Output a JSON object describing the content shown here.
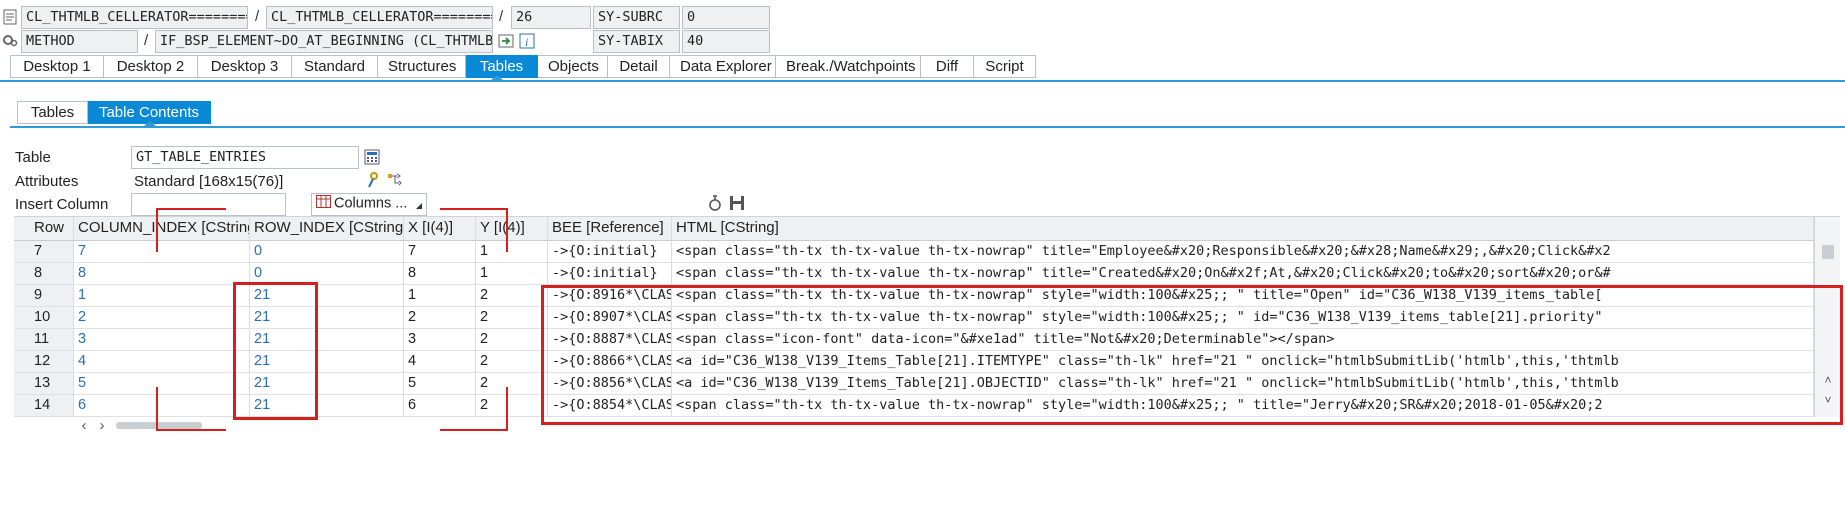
{
  "toolbar": {
    "row1": {
      "class1": "CL_THTMLB_CELLERATOR=========…",
      "class2": "CL_THTMLB_CELLERATOR=========…",
      "line": "26",
      "var_name": "SY-SUBRC",
      "var_value": "0"
    },
    "row2": {
      "kind": "METHOD",
      "method": "IF_BSP_ELEMENT~DO_AT_BEGINNING (CL_THTMLB_C…",
      "var_name": "SY-TABIX",
      "var_value": "40"
    },
    "separator": "/"
  },
  "main_tabs": [
    "Desktop 1",
    "Desktop 2",
    "Desktop 3",
    "Standard",
    "Structures",
    "Tables",
    "Objects",
    "Detail",
    "Data Explorer",
    "Break./Watchpoints",
    "Diff",
    "Script"
  ],
  "main_tab_active": "Tables",
  "sub_tabs": [
    "Tables",
    "Table Contents"
  ],
  "sub_tab_active": "Table Contents",
  "form": {
    "table_label": "Table",
    "table_value": "GT_TABLE_ENTRIES",
    "attributes_label": "Attributes",
    "attributes_value": "Standard [168x15(76)]",
    "insert_column_label": "Insert Column",
    "insert_column_value": "",
    "columns_button": "Columns ..."
  },
  "table": {
    "headers": [
      "Row",
      "COLUMN_INDEX [CString]",
      "ROW_INDEX [CString]",
      "X [I(4)]",
      "Y [I(4)]",
      "BEE [Reference]",
      "HTML [CString]"
    ],
    "rows": [
      [
        "7",
        "7",
        "0",
        "7",
        "1",
        "->{O:initial}",
        "<span class=\"th-tx th-tx-value th-tx-nowrap\"  title=\"Employee&#x20;Responsible&#x20;&#x28;Name&#x29;,&#x20;Click&#x2"
      ],
      [
        "8",
        "8",
        "0",
        "8",
        "1",
        "->{O:initial}",
        "<span class=\"th-tx th-tx-value th-tx-nowrap\"  title=\"Created&#x20;On&#x2f;At,&#x20;Click&#x20;to&#x20;sort&#x20;or&#"
      ],
      [
        "9",
        "1",
        "21",
        "1",
        "2",
        "->{O:8916*\\CLAS…",
        "<span class=\"th-tx th-tx-value th-tx-nowrap\"  style=\"width:100&#x25;; \"  title=\"Open\" id=\"C36_W138_V139_items_table["
      ],
      [
        "10",
        "2",
        "21",
        "2",
        "2",
        "->{O:8907*\\CLAS…",
        "<span class=\"th-tx th-tx-value th-tx-nowrap\"  style=\"width:100&#x25;; \"  id=\"C36_W138_V139_items_table[21].priority\""
      ],
      [
        "11",
        "3",
        "21",
        "3",
        "2",
        "->{O:8887*\\CLAS…",
        "<span class=\"icon-font\" data-icon=\"&#xe1ad\" title=\"Not&#x20;Determinable\"></span>"
      ],
      [
        "12",
        "4",
        "21",
        "4",
        "2",
        "->{O:8866*\\CLAS…",
        "<a id=\"C36_W138_V139_Items_Table[21].ITEMTYPE\" class=\"th-lk\" href=\"21 \" onclick=\"htmlbSubmitLib('htmlb',this,'thtmlb"
      ],
      [
        "13",
        "5",
        "21",
        "5",
        "2",
        "->{O:8856*\\CLAS…",
        "<a id=\"C36_W138_V139_Items_Table[21].OBJECTID\" class=\"th-lk\" href=\"21 \" onclick=\"htmlbSubmitLib('htmlb',this,'thtmlb"
      ],
      [
        "14",
        "6",
        "21",
        "6",
        "2",
        "->{O:8854*\\CLAS…",
        "<span class=\"th-tx th-tx-value th-tx-nowrap\"  style=\"width:100&#x25;; \"  title=\"Jerry&#x20;SR&#x20;2018-01-05&#x20;2"
      ]
    ]
  },
  "colors": {
    "accent": "#0a8ad6",
    "highlight": "#d62020",
    "link": "#2a6fb5"
  },
  "icons": [
    "program-icon",
    "method-gear-icon",
    "navigate-icon",
    "info-icon",
    "calculator-icon",
    "attributes-key-icon",
    "attributes-tree-icon",
    "columns-table-icon",
    "dropdown-icon",
    "search-icon",
    "save-icon",
    "scroll-left-icon",
    "scroll-right-icon",
    "scroll-up-icon",
    "scroll-down-icon"
  ]
}
